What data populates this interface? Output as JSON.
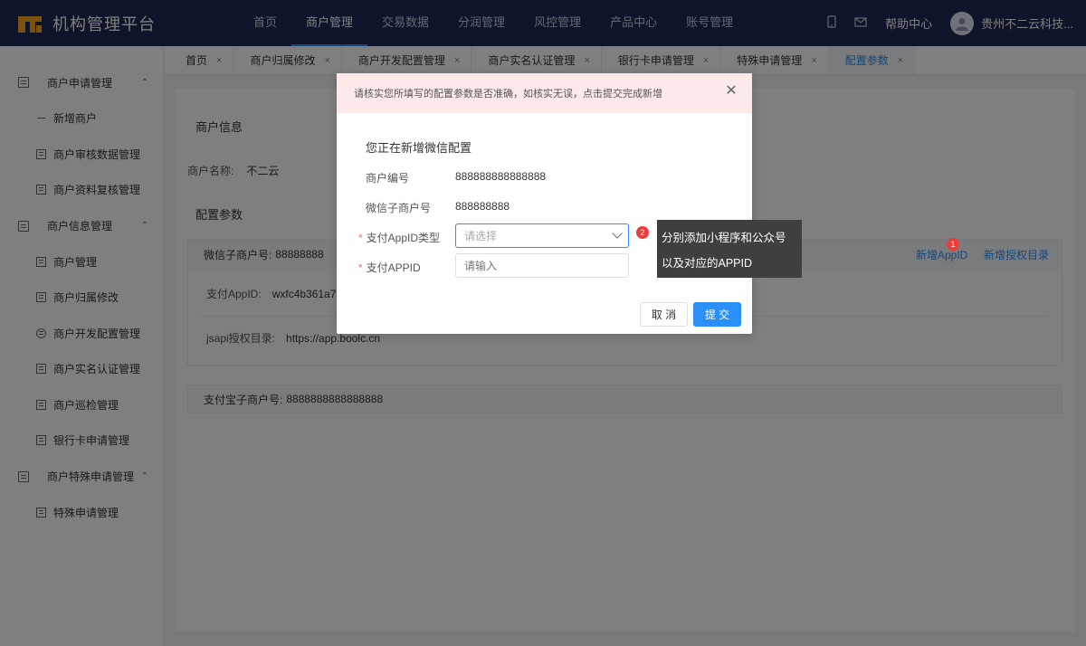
{
  "brand": {
    "name": "机构管理平台"
  },
  "topnav": [
    {
      "label": "首页",
      "active": false
    },
    {
      "label": "商户管理",
      "active": true
    },
    {
      "label": "交易数据",
      "active": false
    },
    {
      "label": "分润管理",
      "active": false
    },
    {
      "label": "风控管理",
      "active": false
    },
    {
      "label": "产品中心",
      "active": false
    },
    {
      "label": "账号管理",
      "active": false
    }
  ],
  "topright": {
    "help": "帮助中心",
    "user": "贵州不二云科技..."
  },
  "sidebar": {
    "groups": [
      {
        "label": "商户申请管理",
        "items": [
          "新增商户",
          "商户审核数据管理",
          "商户资料复核管理"
        ]
      },
      {
        "label": "商户信息管理",
        "items": [
          "商户管理",
          "商户归属修改",
          "商户开发配置管理",
          "商户实名认证管理",
          "商户巡检管理",
          "银行卡申请管理"
        ]
      },
      {
        "label": "商户特殊申请管理",
        "items": [
          "特殊申请管理"
        ]
      }
    ]
  },
  "tabs": [
    {
      "label": "首页",
      "active": false
    },
    {
      "label": "商户归属修改",
      "active": false
    },
    {
      "label": "商户开发配置管理",
      "active": false
    },
    {
      "label": "商户实名认证管理",
      "active": false
    },
    {
      "label": "银行卡申请管理",
      "active": false
    },
    {
      "label": "特殊申请管理",
      "active": false
    },
    {
      "label": "配置参数",
      "active": true
    }
  ],
  "main": {
    "merchant_info_title": "商户信息",
    "merchant_name_label": "商户名称:",
    "merchant_name_value": "不二云",
    "config_title": "配置参数",
    "wechat_sub_label": "微信子商户号:",
    "wechat_sub_value": "88888888",
    "add_appid": "新增AppID",
    "add_auth_dir": "新增授权目录",
    "pay_appid_label": "支付AppID:",
    "pay_appid_value": "wxfc4b361a7a",
    "jsapi_label": "jsapi授权目录:",
    "jsapi_value": "https://app.boolc.cn",
    "alipay_sub_label": "支付宝子商户号:",
    "alipay_sub_value": "8888888888888888"
  },
  "modal": {
    "alert": "请核实您所填写的配置参数是否准确，如核实无误，点击提交完成新增",
    "heading": "您正在新增微信配置",
    "merchant_no_label": "商户编号",
    "merchant_no_value": "888888888888888",
    "wechat_sub_label": "微信子商户号",
    "wechat_sub_value": "888888888",
    "appid_type_label": "支付AppID类型",
    "appid_type_placeholder": "请选择",
    "appid_label": "支付APPID",
    "appid_placeholder": "请输入",
    "cancel": "取 消",
    "submit": "提 交"
  },
  "annotations": {
    "badge1": "1",
    "badge2": "2",
    "tip_line1": "分别添加小程序和公众号",
    "tip_line2": "以及对应的APPID"
  },
  "colors": {
    "accent": "#2a8ff7",
    "topbar": "#1d2b54",
    "brand": "#f4a522",
    "badge": "#ef3b3b"
  }
}
